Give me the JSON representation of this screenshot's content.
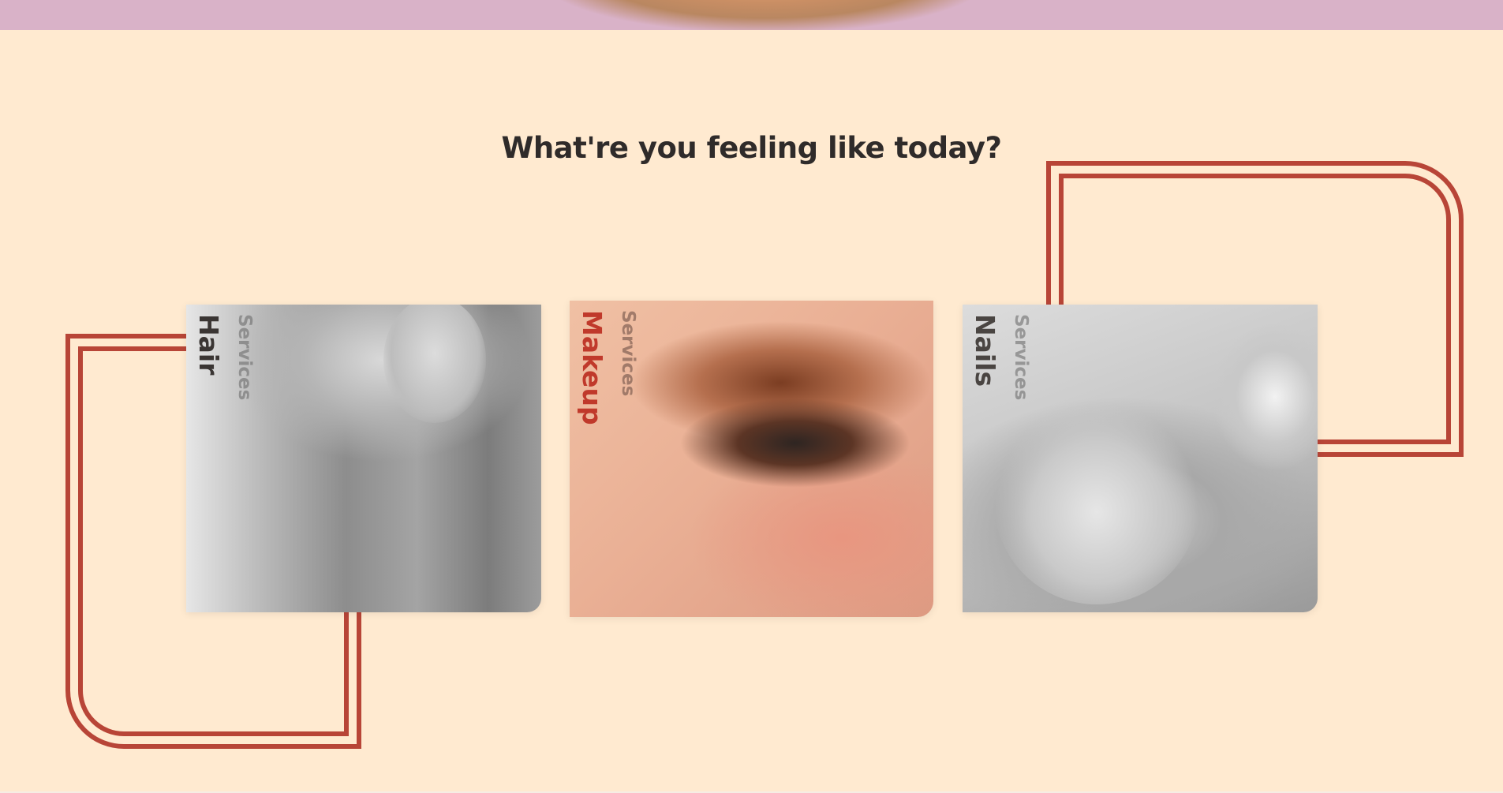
{
  "section": {
    "title": "What're you feeling like today?"
  },
  "services": [
    {
      "name": "Hair",
      "category": "Services"
    },
    {
      "name": "Makeup",
      "category": "Services"
    },
    {
      "name": "Nails",
      "category": "Services"
    }
  ],
  "colors": {
    "background": "#ffead0",
    "accent": "#b84537",
    "banner": "#d9b2c8",
    "text": "#2f2b2a"
  }
}
